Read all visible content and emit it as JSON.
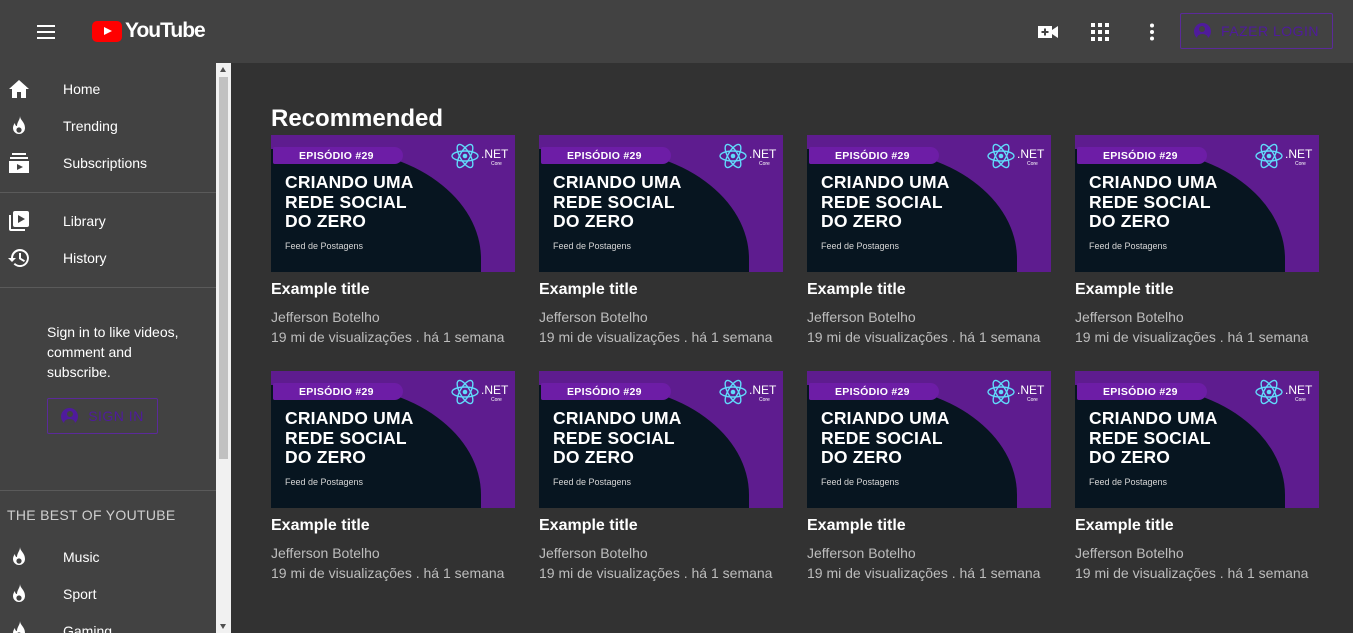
{
  "header": {
    "logo_text": "YouTube",
    "login_label": "FAZER LOGIN"
  },
  "sidebar": {
    "primary": [
      {
        "label": "Home",
        "icon": "home-icon"
      },
      {
        "label": "Trending",
        "icon": "fire-icon"
      },
      {
        "label": "Subscriptions",
        "icon": "subscriptions-icon"
      }
    ],
    "secondary": [
      {
        "label": "Library",
        "icon": "library-icon"
      },
      {
        "label": "History",
        "icon": "history-icon"
      }
    ],
    "signin_text": "Sign in to like videos, comment and subscribe.",
    "signin_label": "SIGN IN",
    "best_title": "THE BEST OF YOUTUBE",
    "best": [
      {
        "label": "Music",
        "icon": "fire-icon"
      },
      {
        "label": "Sport",
        "icon": "fire-icon"
      },
      {
        "label": "Gaming",
        "icon": "fire-icon"
      }
    ]
  },
  "main": {
    "title": "Recommended",
    "thumbnail": {
      "episode": "EPISÓDIO #29",
      "headline": [
        "CRIANDO UMA",
        "REDE SOCIAL",
        "DO ZERO"
      ],
      "subtitle": "Feed de Postagens",
      "brand": ".NET",
      "brand_sub": "Core"
    },
    "videos": [
      {
        "title": "Example title",
        "channel": "Jefferson Botelho",
        "meta": "19 mi de visualizações . há 1 semana"
      },
      {
        "title": "Example title",
        "channel": "Jefferson Botelho",
        "meta": "19 mi de visualizações . há 1 semana"
      },
      {
        "title": "Example title",
        "channel": "Jefferson Botelho",
        "meta": "19 mi de visualizações . há 1 semana"
      },
      {
        "title": "Example title",
        "channel": "Jefferson Botelho",
        "meta": "19 mi de visualizações . há 1 semana"
      },
      {
        "title": "Example title",
        "channel": "Jefferson Botelho",
        "meta": "19 mi de visualizações . há 1 semana"
      },
      {
        "title": "Example title",
        "channel": "Jefferson Botelho",
        "meta": "19 mi de visualizações . há 1 semana"
      },
      {
        "title": "Example title",
        "channel": "Jefferson Botelho",
        "meta": "19 mi de visualizações . há 1 semana"
      },
      {
        "title": "Example title",
        "channel": "Jefferson Botelho",
        "meta": "19 mi de visualizações . há 1 semana"
      }
    ]
  },
  "colors": {
    "topbar": "#424242",
    "background": "#323232",
    "accent": "#4f1b9c",
    "logo_red": "#ff0000"
  }
}
